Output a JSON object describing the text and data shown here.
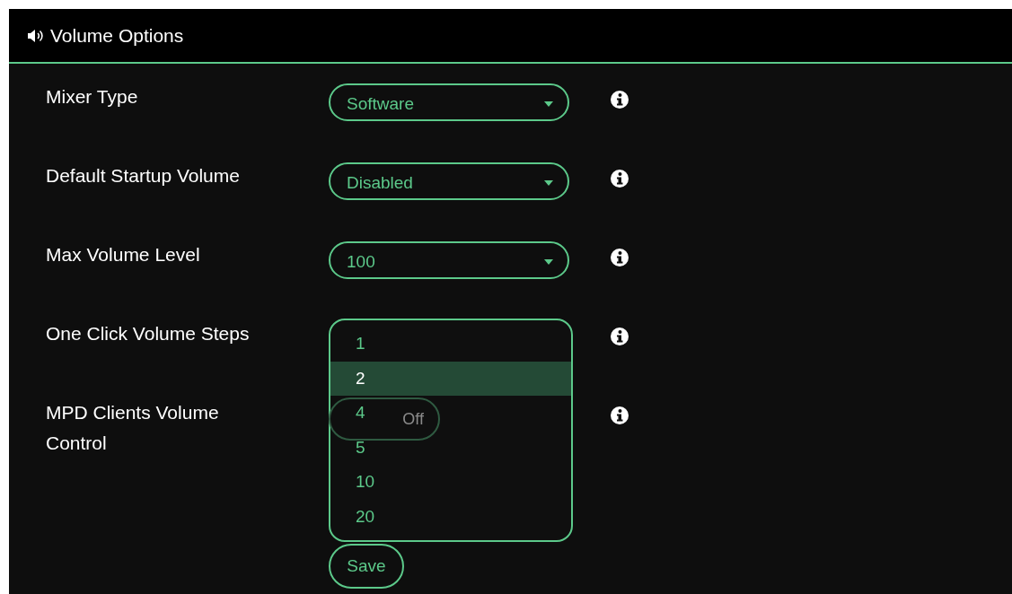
{
  "panel": {
    "title": "Volume Options"
  },
  "settings": [
    {
      "kind": "select",
      "label": "Mixer Type",
      "value": "Software",
      "expanded": false
    },
    {
      "kind": "select",
      "label": "Default Startup Volume",
      "value": "Disabled",
      "expanded": false
    },
    {
      "kind": "select",
      "label": "Max Volume Level",
      "value": "100",
      "expanded": false
    },
    {
      "kind": "select",
      "label": "One Click Volume Steps",
      "expanded": true,
      "options": [
        {
          "label": "1",
          "selected": false
        },
        {
          "label": "2",
          "selected": true
        },
        {
          "label": "4",
          "selected": false
        },
        {
          "label": "5",
          "selected": false
        },
        {
          "label": "10",
          "selected": false
        },
        {
          "label": "20",
          "selected": false
        }
      ]
    },
    {
      "kind": "toggle",
      "label": "MPD Clients Volume Control",
      "on": false,
      "state_label": "Off"
    }
  ],
  "save_button": "Save"
}
